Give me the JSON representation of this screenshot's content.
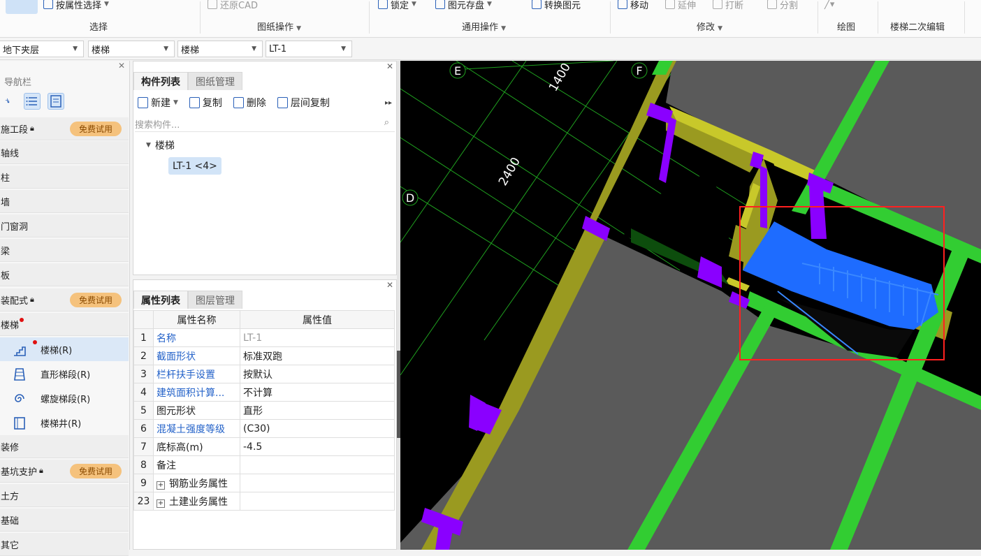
{
  "ribbon": {
    "items": [
      {
        "label": "按属性选择",
        "disabled": false,
        "dropdown": true
      },
      {
        "label": "还原CAD",
        "disabled": true,
        "dropdown": false
      },
      {
        "label": "锁定",
        "disabled": false,
        "dropdown": true
      },
      {
        "label": "图元存盘",
        "disabled": false,
        "dropdown": true
      },
      {
        "label": "转换图元",
        "disabled": false,
        "dropdown": false
      },
      {
        "label": "移动",
        "disabled": false,
        "dropdown": false
      },
      {
        "label": "延伸",
        "disabled": true,
        "dropdown": false
      },
      {
        "label": "打断",
        "disabled": true,
        "dropdown": false
      },
      {
        "label": "分割",
        "disabled": true,
        "dropdown": false
      }
    ],
    "groups": [
      "选择",
      "图纸操作",
      "通用操作",
      "修改",
      "绘图",
      "楼梯二次编辑"
    ]
  },
  "filters": {
    "floor": "地下夹层",
    "category": "楼梯",
    "type": "楼梯",
    "component": "LT-1"
  },
  "nav": {
    "title": "导航栏",
    "trial_badge": "免费试用",
    "categories": [
      {
        "label": "施工段",
        "locked": true,
        "badge": true
      },
      {
        "label": "轴线"
      },
      {
        "label": "柱"
      },
      {
        "label": "墙"
      },
      {
        "label": "门窗洞"
      },
      {
        "label": "梁"
      },
      {
        "label": "板"
      },
      {
        "label": "装配式",
        "locked": true,
        "badge": true
      },
      {
        "label": "楼梯",
        "dot": true
      }
    ],
    "stair_items": [
      {
        "label": "楼梯(R)",
        "selected": true
      },
      {
        "label": "直形梯段(R)"
      },
      {
        "label": "螺旋梯段(R)"
      },
      {
        "label": "楼梯井(R)"
      }
    ],
    "categories_after": [
      {
        "label": "装修"
      },
      {
        "label": "基坑支护",
        "locked": true,
        "badge": true
      },
      {
        "label": "土方"
      },
      {
        "label": "基础"
      },
      {
        "label": "其它"
      }
    ]
  },
  "component_panel": {
    "tabs": [
      "构件列表",
      "图纸管理"
    ],
    "toolbar": [
      "新建",
      "复制",
      "删除",
      "层间复制"
    ],
    "search_placeholder": "搜索构件...",
    "tree_root": "楼梯",
    "tree_item": "LT-1 <4>"
  },
  "property_panel": {
    "tabs": [
      "属性列表",
      "图层管理"
    ],
    "header_name": "属性名称",
    "header_value": "属性值",
    "rows": [
      {
        "num": "1",
        "name": "名称",
        "value": "LT-1",
        "blue": true,
        "gray_value": true
      },
      {
        "num": "2",
        "name": "截面形状",
        "value": "标准双跑",
        "blue": true
      },
      {
        "num": "3",
        "name": "栏杆扶手设置",
        "value": "按默认",
        "blue": true
      },
      {
        "num": "4",
        "name": "建筑面积计算...",
        "value": "不计算",
        "blue": true
      },
      {
        "num": "5",
        "name": "图元形状",
        "value": "直形",
        "blue": false
      },
      {
        "num": "6",
        "name": "混凝土强度等级",
        "value": "(C30)",
        "blue": true
      },
      {
        "num": "7",
        "name": "底标高(m)",
        "value": "-4.5",
        "blue": false
      },
      {
        "num": "8",
        "name": "备注",
        "value": "",
        "blue": false
      },
      {
        "num": "9",
        "name": "钢筋业务属性",
        "value": "",
        "blue": false,
        "expand": true
      },
      {
        "num": "23",
        "name": "土建业务属性",
        "value": "",
        "blue": false,
        "expand": true
      }
    ]
  },
  "viewport": {
    "axis_labels": [
      "E",
      "F",
      "D"
    ],
    "dimensions": [
      "1400",
      "2400"
    ],
    "colors": {
      "background": "#000000",
      "floor": "#5a5a5a",
      "beam": "#32cd32",
      "wall": "#a0a020",
      "column": "#8a00ff",
      "stair": "#1e6cff",
      "selection": "#ff2020",
      "grid": "#1fa01f"
    }
  }
}
